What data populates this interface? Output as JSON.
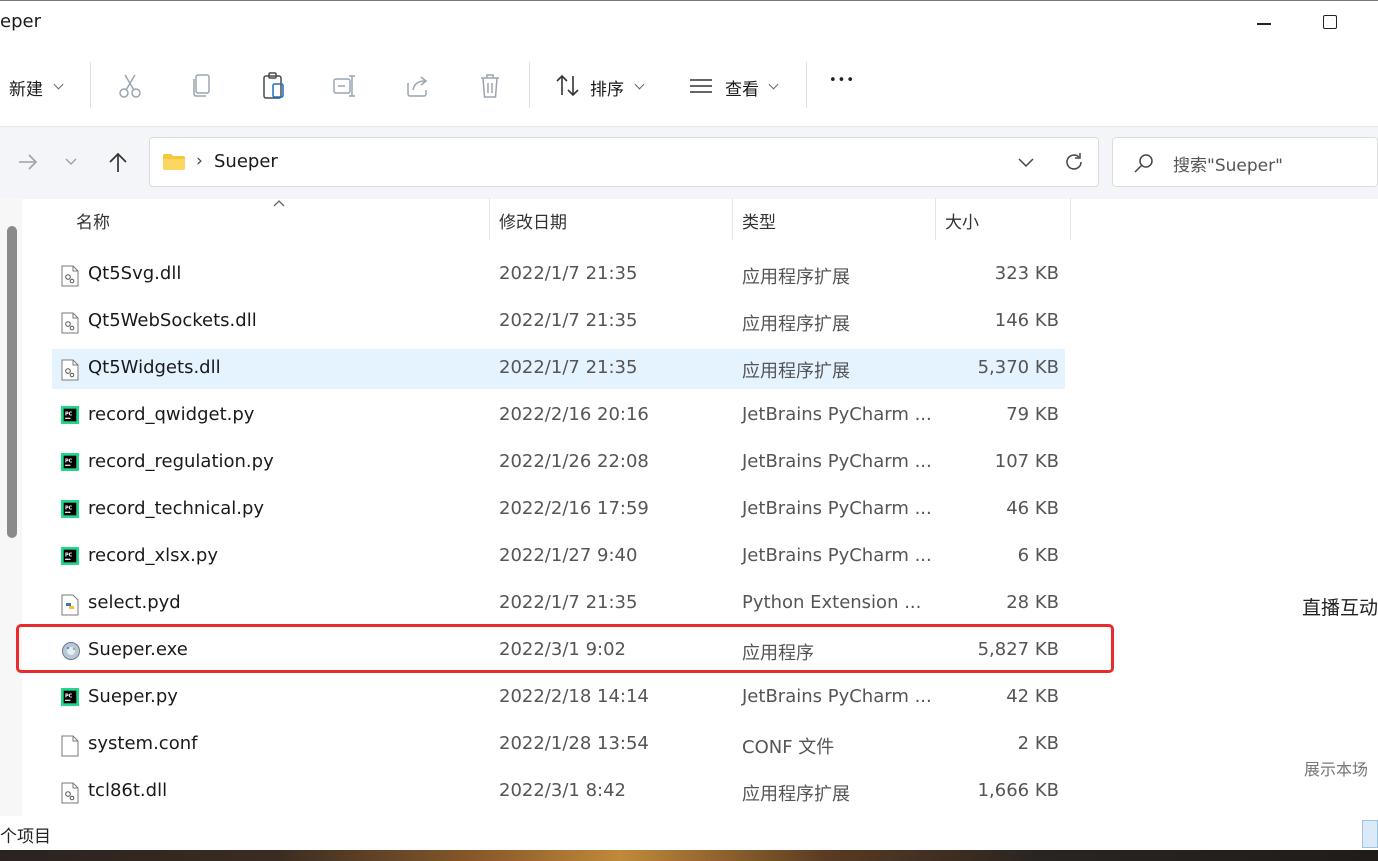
{
  "window": {
    "title": "eper"
  },
  "toolbar": {
    "new_label": "新建",
    "sort_label": "排序",
    "view_label": "查看",
    "more_label": "•••"
  },
  "address": {
    "path": "Sueper",
    "separator": "›",
    "search_placeholder": "搜索\"Sueper\""
  },
  "columns": {
    "name": "名称",
    "date": "修改日期",
    "type": "类型",
    "size": "大小"
  },
  "files": [
    {
      "name": "Qt5Svg.dll",
      "date": "2022/1/7 21:35",
      "type": "应用程序扩展",
      "size": "323 KB",
      "icon": "dll-file-icon"
    },
    {
      "name": "Qt5WebSockets.dll",
      "date": "2022/1/7 21:35",
      "type": "应用程序扩展",
      "size": "146 KB",
      "icon": "dll-file-icon"
    },
    {
      "name": "Qt5Widgets.dll",
      "date": "2022/1/7 21:35",
      "type": "应用程序扩展",
      "size": "5,370 KB",
      "icon": "dll-file-icon"
    },
    {
      "name": "record_qwidget.py",
      "date": "2022/2/16 20:16",
      "type": "JetBrains PyCharm ...",
      "size": "79 KB",
      "icon": "pycharm-file-icon"
    },
    {
      "name": "record_regulation.py",
      "date": "2022/1/26 22:08",
      "type": "JetBrains PyCharm ...",
      "size": "107 KB",
      "icon": "pycharm-file-icon"
    },
    {
      "name": "record_technical.py",
      "date": "2022/2/16 17:59",
      "type": "JetBrains PyCharm ...",
      "size": "46 KB",
      "icon": "pycharm-file-icon"
    },
    {
      "name": "record_xlsx.py",
      "date": "2022/1/27 9:40",
      "type": "JetBrains PyCharm ...",
      "size": "6 KB",
      "icon": "pycharm-file-icon"
    },
    {
      "name": "select.pyd",
      "date": "2022/1/7 21:35",
      "type": "Python Extension ...",
      "size": "28 KB",
      "icon": "python-file-icon"
    },
    {
      "name": "Sueper.exe",
      "date": "2022/3/1 9:02",
      "type": "应用程序",
      "size": "5,827 KB",
      "icon": "exe-file-icon"
    },
    {
      "name": "Sueper.py",
      "date": "2022/2/18 14:14",
      "type": "JetBrains PyCharm ...",
      "size": "42 KB",
      "icon": "pycharm-file-icon"
    },
    {
      "name": "system.conf",
      "date": "2022/1/28 13:54",
      "type": "CONF 文件",
      "size": "2 KB",
      "icon": "blank-file-icon"
    },
    {
      "name": "tcl86t.dll",
      "date": "2022/3/1 8:42",
      "type": "应用程序扩展",
      "size": "1,666 KB",
      "icon": "dll-file-icon"
    }
  ],
  "selected_file": "Qt5Widgets.dll",
  "highlighted_file": "Sueper.exe",
  "status": {
    "count_text": "个项目"
  },
  "background": {
    "side_text_1": "直播互动",
    "side_text_2": "展示本场"
  },
  "colors": {
    "selection": "#e5f3ff",
    "highlight_border": "#e82b2b",
    "pycharm_green": "#21d789"
  }
}
